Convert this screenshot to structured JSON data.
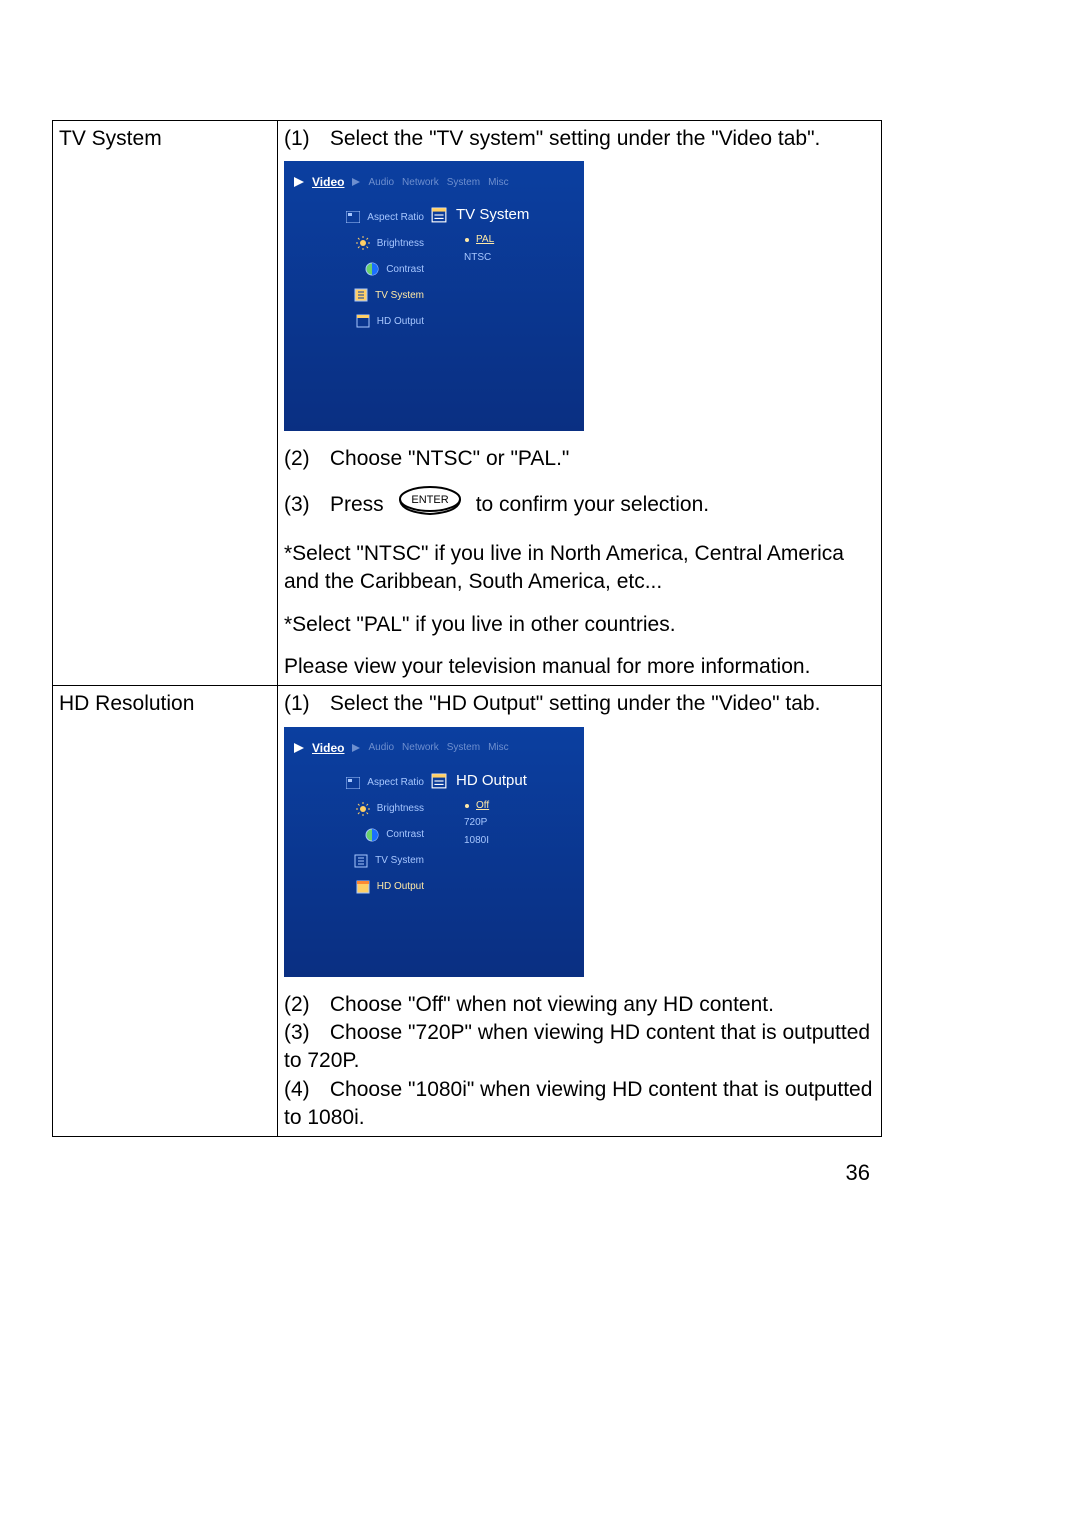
{
  "page_number": "36",
  "rows": {
    "tv_system": {
      "label": "TV System",
      "step1_num": "(1)",
      "step1_text": "Select the \"TV system\" setting under the \"Video tab\".",
      "step2_num": "(2)",
      "step2_text": "Choose \"NTSC\" or \"PAL.\"",
      "step3_num": "(3)",
      "step3_pre": "Press",
      "step3_post": "to confirm your selection.",
      "note1": "*Select \"NTSC\" if you live in North America, Central America and the Caribbean, South America, etc...",
      "note2": "*Select \"PAL\" if you live in other countries.",
      "note3": "Please view your television manual for more information.",
      "screenshot": {
        "tabs": {
          "active": "Video",
          "t1": "Audio",
          "t2": "Network",
          "t3": "System",
          "t4": "Misc"
        },
        "menu": {
          "i0": "Aspect Ratio",
          "i1": "Brightness",
          "i2": "Contrast",
          "i3": "TV System",
          "i4": "HD Output"
        },
        "panel_title": "TV System",
        "options": {
          "o0": "PAL",
          "o1": "NTSC"
        }
      }
    },
    "hd_resolution": {
      "label": "HD Resolution",
      "step1_num": "(1)",
      "step1_text": "Select the \"HD Output\" setting under the \"Video\" tab.",
      "step2_num": "(2)",
      "step2_text": "Choose \"Off\" when not viewing any HD content.",
      "step3_num": "(3)",
      "step3_text": "Choose \"720P\" when viewing HD content that is outputted to 720P.",
      "step4_num": "(4)",
      "step4_text": "Choose \"1080i\" when viewing HD content that is outputted to 1080i.",
      "screenshot": {
        "tabs": {
          "active": "Video",
          "t1": "Audio",
          "t2": "Network",
          "t3": "System",
          "t4": "Misc"
        },
        "menu": {
          "i0": "Aspect Ratio",
          "i1": "Brightness",
          "i2": "Contrast",
          "i3": "TV System",
          "i4": "HD Output"
        },
        "panel_title": "HD Output",
        "options": {
          "o0": "Off",
          "o1": "720P",
          "o2": "1080I"
        }
      }
    }
  },
  "buttons": {
    "enter": "ENTER"
  }
}
